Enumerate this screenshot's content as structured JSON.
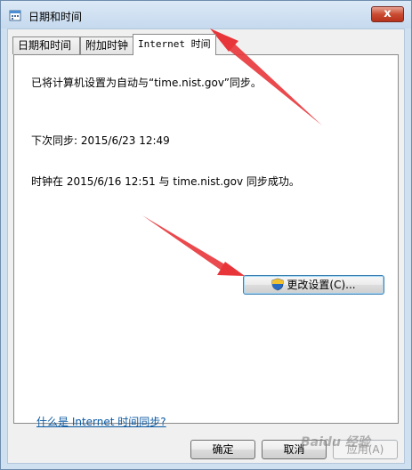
{
  "window": {
    "title": "日期和时间",
    "close_label": "x"
  },
  "tabs": [
    {
      "label": "日期和时间",
      "active": false
    },
    {
      "label": "附加时钟",
      "active": false
    },
    {
      "label": "Internet 时间",
      "active": true
    }
  ],
  "panel": {
    "auto_sync_text": "已将计算机设置为自动与“time.nist.gov”同步。",
    "next_sync_text": "下次同步: 2015/6/23 12:49",
    "last_sync_text": "时钟在 2015/6/16 12:51 与 time.nist.gov 同步成功。",
    "change_settings_label": "更改设置(C)...",
    "help_link": "什么是 Internet 时间同步?"
  },
  "footer": {
    "ok_label": "确定",
    "cancel_label": "取消",
    "apply_label": "应用(A)"
  },
  "watermark": "Baidu 经验",
  "colors": {
    "annotation_arrow": "#e8353a",
    "link": "#0b5aa3"
  }
}
